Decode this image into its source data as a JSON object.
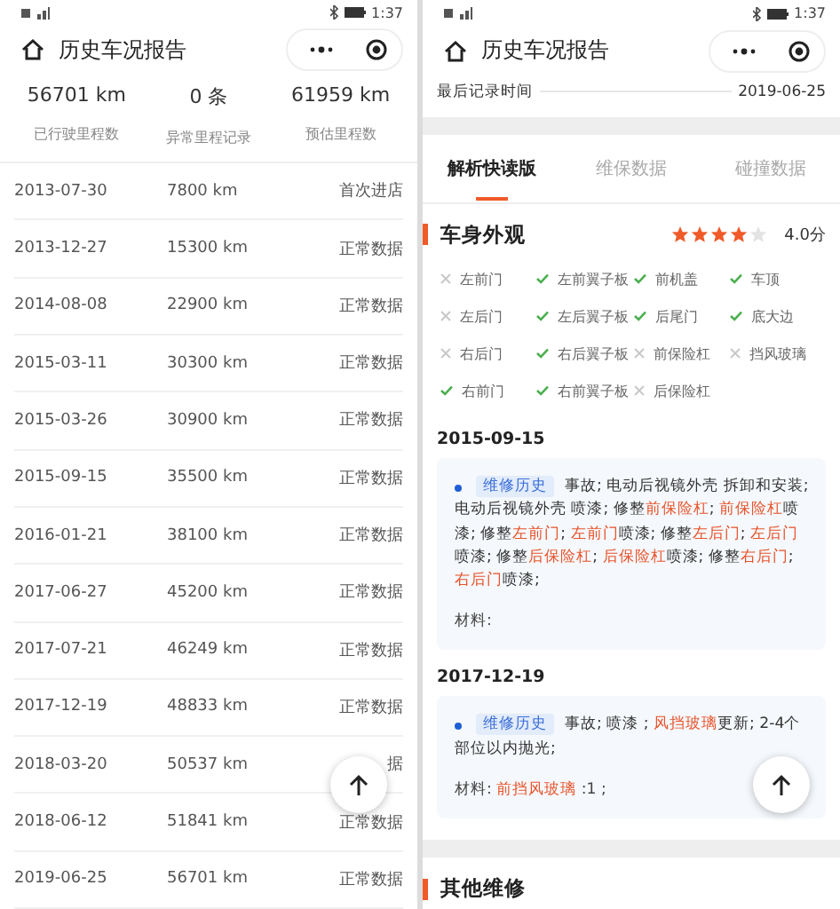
{
  "left": {
    "status_time": "1:37",
    "title": "历史车况报告",
    "stats": [
      {
        "value": "56701 km",
        "label": "已行驶里程数"
      },
      {
        "value": "0 条",
        "label": "异常里程记录"
      },
      {
        "value": "61959 km",
        "label": "预估里程数"
      }
    ],
    "rows": [
      {
        "date": "2013-07-30",
        "mileage": "7800 km",
        "status": "首次进店"
      },
      {
        "date": "2013-12-27",
        "mileage": "15300 km",
        "status": "正常数据"
      },
      {
        "date": "2014-08-08",
        "mileage": "22900 km",
        "status": "正常数据"
      },
      {
        "date": "2015-03-11",
        "mileage": "30300 km",
        "status": "正常数据"
      },
      {
        "date": "2015-03-26",
        "mileage": "30900 km",
        "status": "正常数据"
      },
      {
        "date": "2015-09-15",
        "mileage": "35500 km",
        "status": "正常数据"
      },
      {
        "date": "2016-01-21",
        "mileage": "38100 km",
        "status": "正常数据"
      },
      {
        "date": "2017-06-27",
        "mileage": "45200 km",
        "status": "正常数据"
      },
      {
        "date": "2017-07-21",
        "mileage": "46249 km",
        "status": "正常数据"
      },
      {
        "date": "2017-12-19",
        "mileage": "48833 km",
        "status": "正常数据"
      },
      {
        "date": "2018-03-20",
        "mileage": "50537 km",
        "status": "据"
      },
      {
        "date": "2018-06-12",
        "mileage": "51841 km",
        "status": "正常数据"
      },
      {
        "date": "2019-06-25",
        "mileage": "56701 km",
        "status": "正常数据"
      }
    ]
  },
  "right": {
    "status_time": "1:37",
    "title": "历史车况报告",
    "last_record": {
      "label": "最后记录时间",
      "value": "2019-06-25"
    },
    "tabs": [
      {
        "label": "解析快读版",
        "selected": true
      },
      {
        "label": "维保数据",
        "selected": false
      },
      {
        "label": "碰撞数据",
        "selected": false
      }
    ],
    "appearance": {
      "title": "车身外观",
      "stars": 4,
      "score": "4.0分",
      "parts": [
        {
          "name": "左前门",
          "ok": false
        },
        {
          "name": "左前翼子板",
          "ok": true
        },
        {
          "name": "前机盖",
          "ok": true
        },
        {
          "name": "车顶",
          "ok": true
        },
        {
          "name": "左后门",
          "ok": false
        },
        {
          "name": "左后翼子板",
          "ok": true
        },
        {
          "name": "后尾门",
          "ok": true
        },
        {
          "name": "底大边",
          "ok": true
        },
        {
          "name": "右后门",
          "ok": false
        },
        {
          "name": "右后翼子板",
          "ok": true
        },
        {
          "name": "前保险杠",
          "ok": false
        },
        {
          "name": "挡风玻璃",
          "ok": false
        },
        {
          "name": "右前门",
          "ok": true
        },
        {
          "name": "右前翼子板",
          "ok": true
        },
        {
          "name": "后保险杠",
          "ok": false
        }
      ]
    },
    "records": [
      {
        "date": "2015-09-15",
        "tag": "维修历史",
        "description": [
          {
            "t": "事故; 电动后视镜外壳 拆卸和安装; 电动后视镜外壳 喷漆; 修整",
            "hl": false
          },
          {
            "t": "前保险杠",
            "hl": true
          },
          {
            "t": "; ",
            "hl": false
          },
          {
            "t": "前保险杠",
            "hl": true
          },
          {
            "t": "喷漆; 修整",
            "hl": false
          },
          {
            "t": "左前门",
            "hl": true
          },
          {
            "t": "; ",
            "hl": false
          },
          {
            "t": "左前门",
            "hl": true
          },
          {
            "t": "喷漆; 修整",
            "hl": false
          },
          {
            "t": "左后门",
            "hl": true
          },
          {
            "t": "; ",
            "hl": false
          },
          {
            "t": "左后门",
            "hl": true
          },
          {
            "t": "喷漆; 修整",
            "hl": false
          },
          {
            "t": "后保险杠",
            "hl": true
          },
          {
            "t": "; ",
            "hl": false
          },
          {
            "t": "后保险杠",
            "hl": true
          },
          {
            "t": "喷漆; 修整",
            "hl": false
          },
          {
            "t": "右后门",
            "hl": true
          },
          {
            "t": "; ",
            "hl": false
          },
          {
            "t": "右后门",
            "hl": true
          },
          {
            "t": "喷漆;",
            "hl": false
          }
        ],
        "material": [
          {
            "t": "材料:",
            "hl": false
          }
        ]
      },
      {
        "date": "2017-12-19",
        "tag": "维修历史",
        "description": [
          {
            "t": "事故; 喷漆 ; ",
            "hl": false
          },
          {
            "t": "风挡玻璃",
            "hl": true
          },
          {
            "t": "更新; 2-4个部位以内抛光;",
            "hl": false
          }
        ],
        "material": [
          {
            "t": "材料: ",
            "hl": false
          },
          {
            "t": "前挡风玻璃",
            "hl": true
          },
          {
            "t": " :1 ;",
            "hl": false
          }
        ]
      }
    ],
    "next_section": "其他维修"
  }
}
